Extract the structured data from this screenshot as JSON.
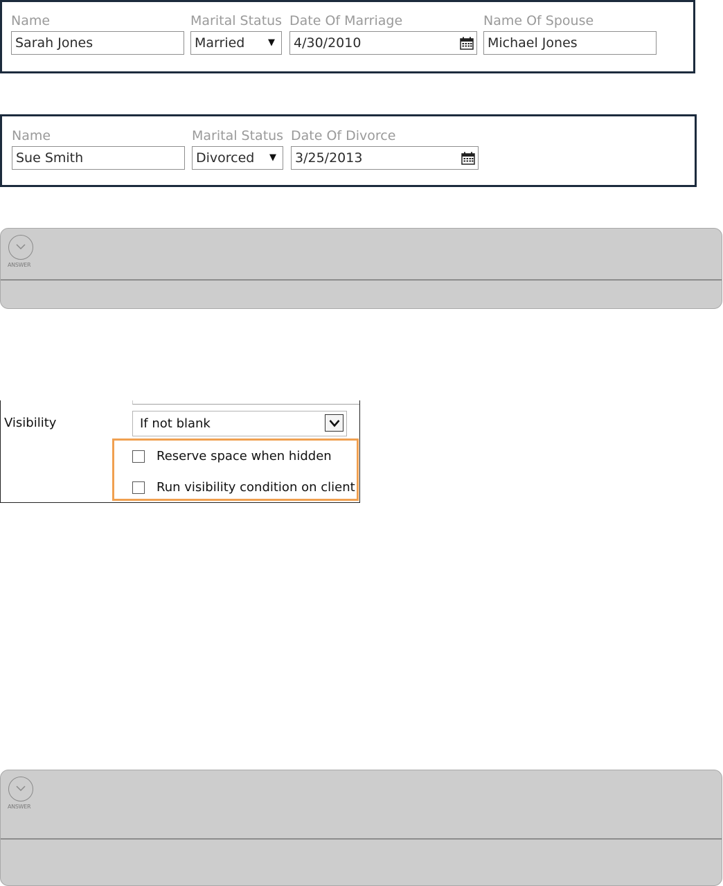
{
  "married_form": {
    "name": {
      "label": "Name",
      "value": "Sarah Jones"
    },
    "marital_status": {
      "label": "Marital Status",
      "value": "Married"
    },
    "date_of_marriage": {
      "label": "Date Of Marriage",
      "value": "4/30/2010"
    },
    "name_of_spouse": {
      "label": "Name Of Spouse",
      "value": "Michael Jones"
    }
  },
  "divorced_form": {
    "name": {
      "label": "Name",
      "value": "Sue Smith"
    },
    "marital_status": {
      "label": "Marital Status",
      "value": "Divorced"
    },
    "date_of_divorce": {
      "label": "Date Of Divorce",
      "value": "3/25/2013"
    }
  },
  "answer_panels": [
    {
      "toggle_label": "ANSWER",
      "icon": "chevron-down-circle-icon"
    },
    {
      "toggle_label": "ANSWER",
      "icon": "chevron-down-circle-icon"
    }
  ],
  "visibility_settings": {
    "label": "Visibility",
    "selected": "If not blank",
    "options": {
      "reserve_space": {
        "label": "Reserve space when hidden",
        "checked": false
      },
      "run_on_client": {
        "label": "Run visibility condition on client",
        "checked": false
      }
    },
    "highlight_color": "#f0a050"
  },
  "colors": {
    "panel_border": "#1c2b3d",
    "answer_background": "#cdcdcd",
    "field_label": "#9a9a9a"
  }
}
